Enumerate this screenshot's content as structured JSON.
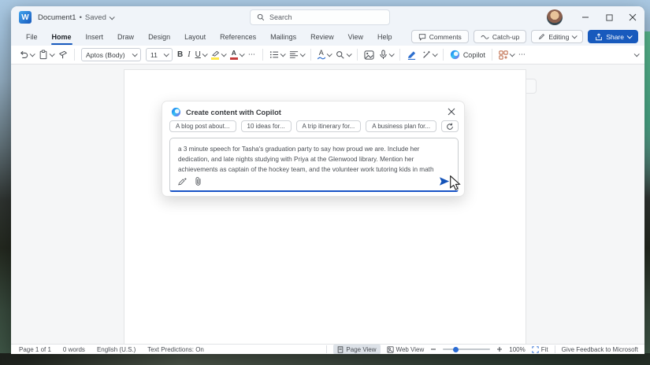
{
  "titlebar": {
    "document_title": "Document1",
    "separator": "•",
    "save_status": "Saved",
    "search_placeholder": "Search"
  },
  "icons": {
    "word_logo_letter": "W"
  },
  "tabs": {
    "items": [
      "File",
      "Home",
      "Insert",
      "Draw",
      "Design",
      "Layout",
      "References",
      "Mailings",
      "Review",
      "View",
      "Help"
    ],
    "active": "Home"
  },
  "tab_actions": {
    "comments": "Comments",
    "catch_up": "Catch-up",
    "editing": "Editing",
    "share": "Share"
  },
  "ribbon": {
    "font_name": "Aptos (Body)",
    "font_size": "11",
    "bold": "B",
    "italic": "I",
    "underline": "U",
    "font_color_letter": "A",
    "styles_letter": "A",
    "more": "⋯",
    "more_options": "⋯",
    "copilot": "Copilot"
  },
  "copilot_dialog": {
    "title": "Create content with Copilot",
    "chips": [
      "A blog post about...",
      "10 ideas for...",
      "A trip itinerary for...",
      "A business plan for..."
    ],
    "prompt_text": "a 3 minute speech for Tasha's graduation party to say how proud we are. Include her dedication, and late nights studying with Priya at the Glenwood library. Mention her achievements as captain of the hockey team, and the volunteer work tutoring kids in math"
  },
  "statusbar": {
    "page_info": "Page 1 of 1",
    "word_count": "0 words",
    "language": "English (U.S.)",
    "text_predictions": "Text Predictions: On",
    "page_view": "Page View",
    "web_view": "Web View",
    "zoom_percent": "100%",
    "fit": "Fit",
    "feedback": "Give Feedback to Microsoft"
  },
  "colors": {
    "accent_blue": "#185abd",
    "highlight_yellow": "#ffe84a",
    "font_color_red": "#c53b3b"
  }
}
